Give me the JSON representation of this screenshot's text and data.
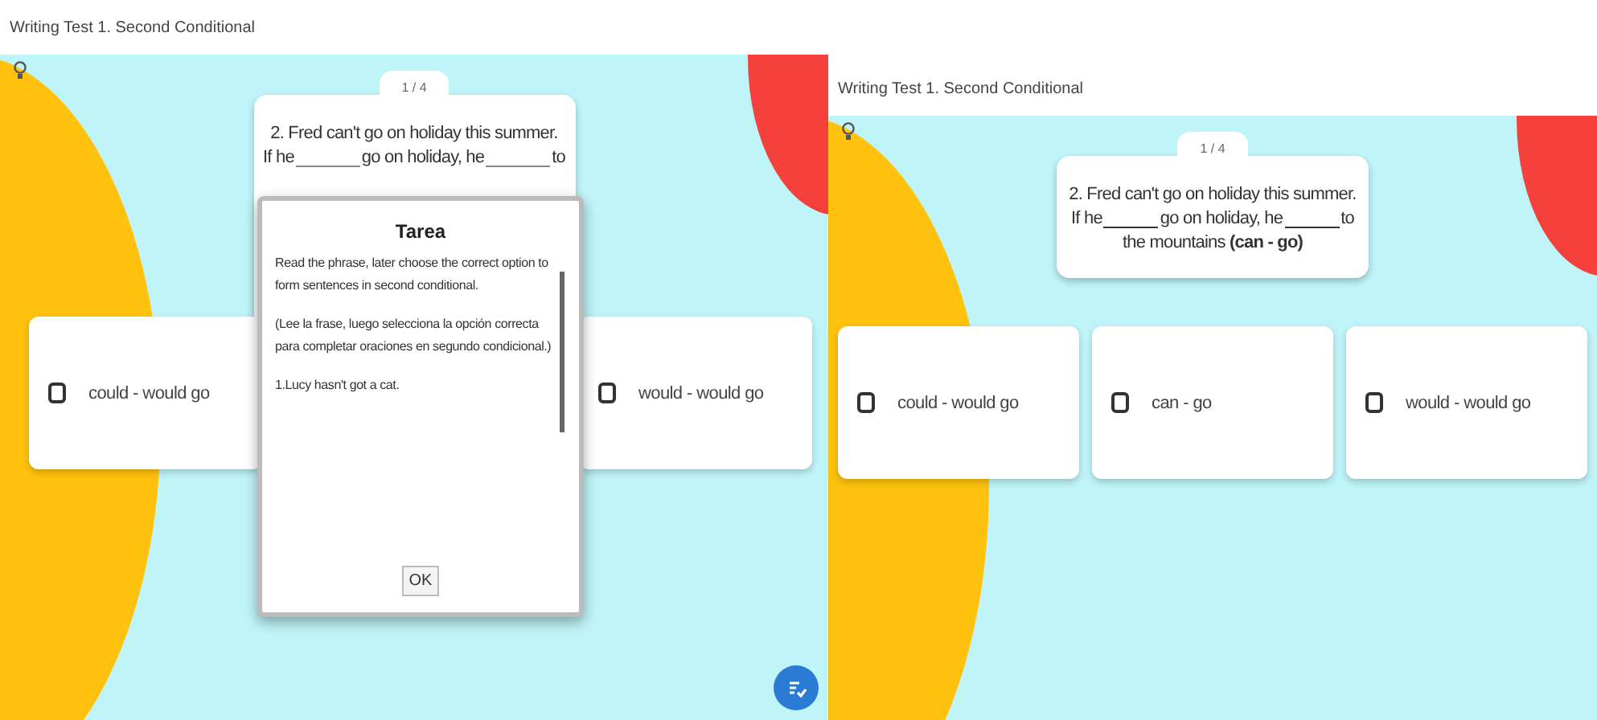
{
  "screens": [
    {
      "title": "Writing Test 1. Second Conditional",
      "counter": "1 / 4",
      "question_lines": [
        [
          {
            "kind": "text",
            "text": "2. Fred can't go on holiday this summer."
          }
        ],
        [
          {
            "kind": "text",
            "text": "If he"
          },
          {
            "kind": "blank"
          },
          {
            "kind": "text",
            "text": "go on holiday, he"
          },
          {
            "kind": "blank"
          },
          {
            "kind": "text",
            "text": "to"
          }
        ]
      ],
      "options": [
        {
          "label": "could - would go",
          "checked": false
        },
        {
          "label": "would - would go",
          "checked": false
        }
      ],
      "dialog": {
        "title": "Tarea",
        "paragraphs": [
          "Read the phrase, later choose the correct option to form sentences in second conditional.",
          "(Lee la frase, luego selecciona la opción correcta para completar oraciones en segundo condicional.)",
          "1.Lucy hasn't got a cat."
        ],
        "button": "OK"
      },
      "check_button": true
    },
    {
      "title": "Writing Test 1. Second Conditional",
      "counter": "1 / 4",
      "question_lines": [
        [
          {
            "kind": "text",
            "text": "2. Fred can't go on holiday this summer."
          }
        ],
        [
          {
            "kind": "text",
            "text": "If he"
          },
          {
            "kind": "blank"
          },
          {
            "kind": "text",
            "text": "go on holiday, he"
          },
          {
            "kind": "blank"
          },
          {
            "kind": "text",
            "text": "to"
          }
        ],
        [
          {
            "kind": "text",
            "text": "the mountains **(can - go)**"
          }
        ]
      ],
      "options": [
        {
          "label": "could - would go",
          "checked": false
        },
        {
          "label": "can - go",
          "checked": false
        },
        {
          "label": "would - would go",
          "checked": false
        }
      ]
    }
  ]
}
